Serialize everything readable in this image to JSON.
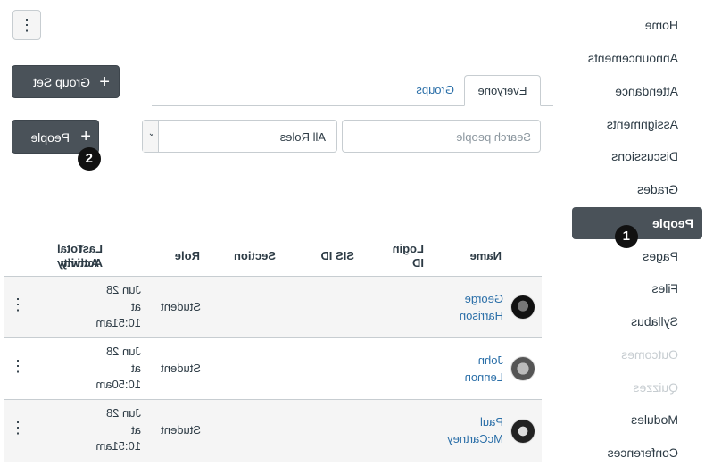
{
  "course_nav": {
    "items": [
      {
        "label": "Home"
      },
      {
        "label": "Announcements"
      },
      {
        "label": "Attendance"
      },
      {
        "label": "Assignments"
      },
      {
        "label": "Discussions"
      },
      {
        "label": "Grades"
      },
      {
        "label": "People"
      },
      {
        "label": "Pages"
      },
      {
        "label": "Files"
      },
      {
        "label": "Syllabus"
      },
      {
        "label": "Outcomes"
      },
      {
        "label": "Quizzes"
      },
      {
        "label": "Modules"
      },
      {
        "label": "Conferences"
      }
    ],
    "active_badge": "1"
  },
  "toolbar": {
    "group_set_label": "Group Set",
    "add_people_label": "People",
    "add_people_badge": "2"
  },
  "tabs": [
    {
      "label": "Everyone"
    },
    {
      "label": "Groups"
    }
  ],
  "search": {
    "placeholder": "Search people"
  },
  "roles_select": {
    "value": "All Roles"
  },
  "table": {
    "headers": {
      "name": "Name",
      "login_id": [
        "Login",
        "ID"
      ],
      "sis_id": "SIS ID",
      "section": "Section",
      "role": "Role",
      "last_activity": [
        "Last",
        "Activity"
      ],
      "total_activity": [
        "Total",
        "Activity"
      ]
    },
    "rows": [
      {
        "first": "George",
        "last": "Harrison",
        "role": "Student",
        "activity": [
          "Jun 28",
          "at",
          "10:51am"
        ]
      },
      {
        "first": "John",
        "last": "Lennon",
        "role": "Student",
        "activity": [
          "Jun 28",
          "at",
          "10:50am"
        ]
      },
      {
        "first": "Paul",
        "last": "McCartney",
        "role": "Student",
        "activity": [
          "Jun 28",
          "at",
          "10:51am"
        ]
      }
    ]
  },
  "colors": {
    "link": "#2b6fa8",
    "dark_button": "#4a5259",
    "active_nav": "#4a5259"
  }
}
